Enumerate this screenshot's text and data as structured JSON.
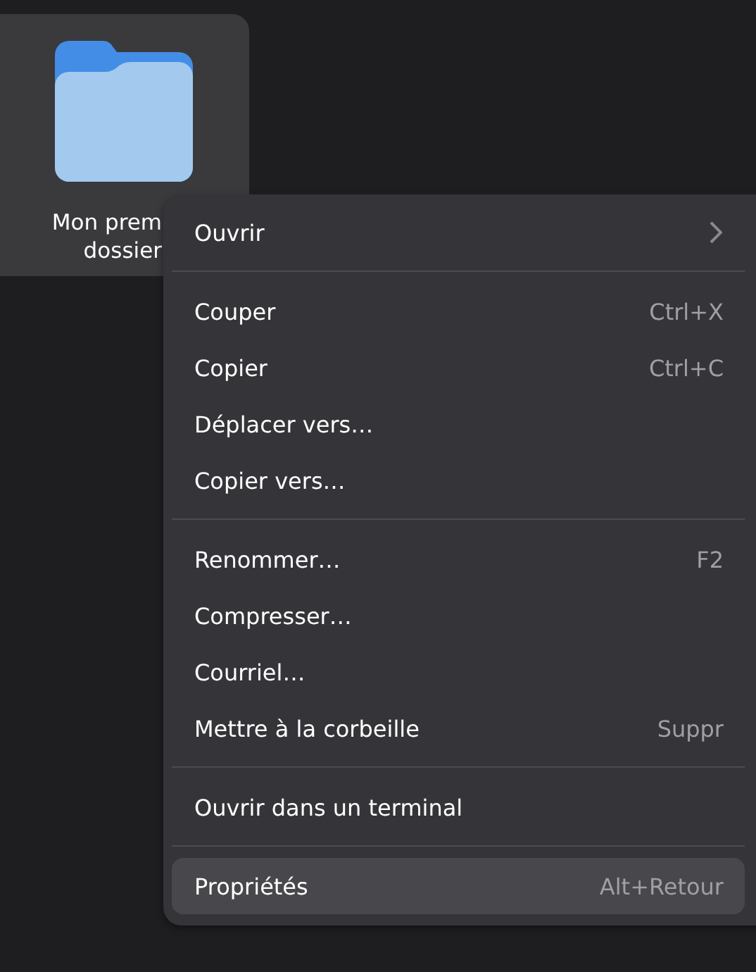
{
  "folder": {
    "label_lines": [
      "Mon prem",
      "dossier"
    ]
  },
  "menu": {
    "sections": [
      [
        {
          "label": "Ouvrir",
          "submenu": true,
          "selected": false
        }
      ],
      [
        {
          "label": "Couper",
          "shortcut": "Ctrl+X",
          "submenu": false,
          "selected": false
        },
        {
          "label": "Copier",
          "shortcut": "Ctrl+C",
          "submenu": false,
          "selected": false
        },
        {
          "label": "Déplacer vers…",
          "submenu": false,
          "selected": false
        },
        {
          "label": "Copier vers…",
          "submenu": false,
          "selected": false
        }
      ],
      [
        {
          "label": "Renommer…",
          "shortcut": "F2",
          "submenu": false,
          "selected": false
        },
        {
          "label": "Compresser…",
          "submenu": false,
          "selected": false
        },
        {
          "label": "Courriel…",
          "submenu": false,
          "selected": false
        },
        {
          "label": "Mettre à la corbeille",
          "shortcut": "Suppr",
          "submenu": false,
          "selected": false
        }
      ],
      [
        {
          "label": "Ouvrir dans un terminal",
          "submenu": false,
          "selected": false
        }
      ],
      [
        {
          "label": "Propriétés",
          "shortcut": "Alt+Retour",
          "submenu": false,
          "selected": true
        }
      ]
    ]
  }
}
